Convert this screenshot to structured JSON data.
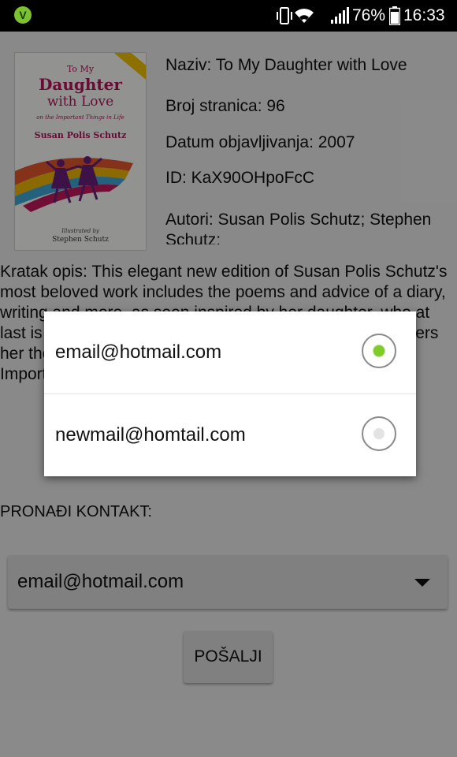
{
  "status_bar": {
    "app_icon_letter": "V",
    "battery_percent": "76%",
    "time": "16:33"
  },
  "book": {
    "cover": {
      "line1": "To My",
      "line2": "Daughter",
      "line3": "with Love",
      "subtitle": "on the Important Things in Life",
      "author": "Susan Polis Schutz",
      "illustrated_by": "Illustrated by",
      "illustrator": "Stephen Schutz"
    },
    "naziv": "Naziv: To My Daughter with Love",
    "broj_stranica": "Broj stranica: 96",
    "datum": "Datum objavljivanja: 2007",
    "id": "ID: KaX90OHpoFcC",
    "autori": "Autori: Susan Polis Schutz; Stephen Schutz;",
    "opis": "Kratak opis: This elegant new edition of Susan Polis Schutz's most beloved work includes the poems and advice of a diary, writing and more, as seen inspired by her daughter, who at last is going to be leaving home... Susan Polis Schutz offers her thoughts on her hopes for this daughter, and on the Important Things in Life, like education"
  },
  "contact": {
    "label": "PRONAĐI KONTAKT:",
    "selected": "email@hotmail.com",
    "send_label": "POŠALJI"
  },
  "dialog": {
    "options": [
      {
        "label": "email@hotmail.com",
        "checked": true
      },
      {
        "label": "newmail@homtail.com",
        "checked": false
      }
    ]
  },
  "colors": {
    "radio_checked": "#7ecb29",
    "status_bar": "#000000"
  }
}
